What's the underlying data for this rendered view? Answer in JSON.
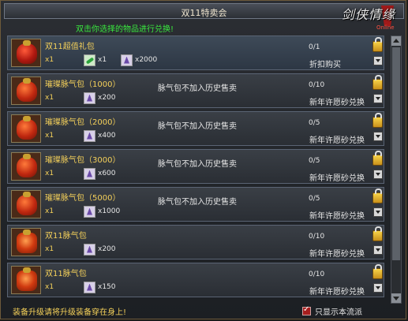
{
  "window": {
    "title": "双11特卖会"
  },
  "logo": {
    "text": "剑侠情缘",
    "sub": "Online"
  },
  "hint": "双击你选择的物品进行兑换!",
  "items": [
    {
      "name": "双11超值礼包",
      "qty": "x1",
      "costs": [
        {
          "icon": "leaf-icon",
          "value": "x1"
        },
        {
          "icon": "crystal-icon",
          "value": "x2000"
        }
      ],
      "note": "",
      "limit": "0/1",
      "action": "折扣购买",
      "bag": "gift"
    },
    {
      "name": "璀璨脉气包（1000）",
      "qty": "x1",
      "costs": [
        {
          "icon": "crystal-icon",
          "value": "x200"
        }
      ],
      "note": "脉气包不加入历史售卖",
      "limit": "0/10",
      "action": "新年许愿砂兑换",
      "bag": ""
    },
    {
      "name": "璀璨脉气包（2000）",
      "qty": "x1",
      "costs": [
        {
          "icon": "crystal-icon",
          "value": "x400"
        }
      ],
      "note": "脉气包不加入历史售卖",
      "limit": "0/5",
      "action": "新年许愿砂兑换",
      "bag": ""
    },
    {
      "name": "璀璨脉气包（3000）",
      "qty": "x1",
      "costs": [
        {
          "icon": "crystal-icon",
          "value": "x600"
        }
      ],
      "note": "脉气包不加入历史售卖",
      "limit": "0/5",
      "action": "新年许愿砂兑换",
      "bag": ""
    },
    {
      "name": "璀璨脉气包（5000）",
      "qty": "x1",
      "costs": [
        {
          "icon": "crystal-icon",
          "value": "x1000"
        }
      ],
      "note": "脉气包不加入历史售卖",
      "limit": "0/5",
      "action": "新年许愿砂兑换",
      "bag": ""
    },
    {
      "name": "双11脉气包",
      "qty": "x1",
      "costs": [
        {
          "icon": "crystal-icon",
          "value": "x200"
        }
      ],
      "note": "",
      "limit": "0/10",
      "action": "新年许愿砂兑换",
      "bag": "fancy"
    },
    {
      "name": "双11脉气包",
      "qty": "x1",
      "costs": [
        {
          "icon": "crystal-icon",
          "value": "x150"
        }
      ],
      "note": "",
      "limit": "0/10",
      "action": "新年许愿砂兑换",
      "bag": "fancy"
    }
  ],
  "footer": {
    "tip": "装备升级请将升级装备穿在身上!",
    "filter_label": "只显示本流派",
    "filter_checked": true
  }
}
